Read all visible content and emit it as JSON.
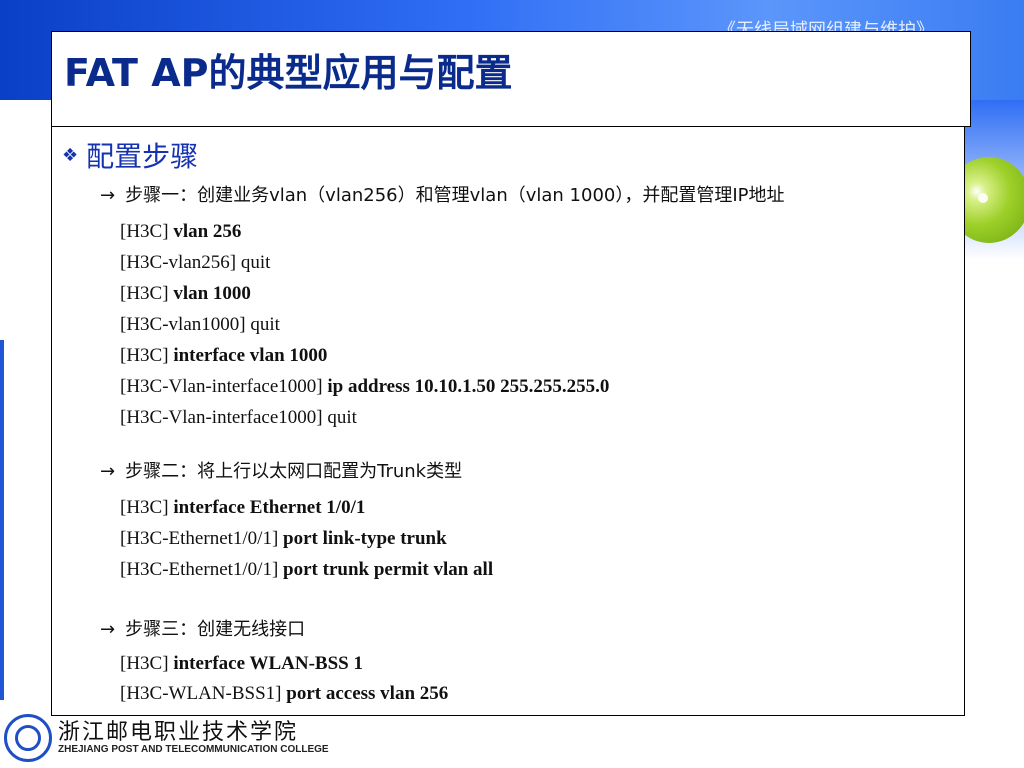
{
  "banner": {
    "course_title": "《无线局域网组建与维护》"
  },
  "slide": {
    "title": "FAT AP的典型应用与配置",
    "heading_bullet": "❖",
    "heading": "配置步骤",
    "arrow": "→",
    "steps": [
      {
        "label": "步骤一：创建业务vlan（vlan256）和管理vlan（vlan 1000），并配置管理IP地址",
        "commands": [
          {
            "prompt": "[H3C]",
            "cmd": "vlan 256"
          },
          {
            "prompt": "[H3C-vlan256] quit",
            "cmd": ""
          },
          {
            "prompt": "[H3C]",
            "cmd": "vlan 1000"
          },
          {
            "prompt": "[H3C-vlan1000] quit",
            "cmd": ""
          },
          {
            "prompt": "[H3C]",
            "cmd": "interface vlan 1000"
          },
          {
            "prompt": "[H3C-Vlan-interface1000]",
            "cmd": "ip address 10.10.1.50 255.255.255.0"
          },
          {
            "prompt": "[H3C-Vlan-interface1000] quit",
            "cmd": ""
          }
        ]
      },
      {
        "label": "步骤二：将上行以太网口配置为Trunk类型",
        "commands": [
          {
            "prompt": "[H3C]",
            "cmd": "interface Ethernet 1/0/1"
          },
          {
            "prompt": "[H3C-Ethernet1/0/1]",
            "cmd": "port link-type trunk"
          },
          {
            "prompt": "[H3C-Ethernet1/0/1]",
            "cmd": "port trunk permit vlan all"
          }
        ]
      },
      {
        "label": "步骤三：创建无线接口",
        "commands": [
          {
            "prompt": "[H3C]",
            "cmd": "interface WLAN-BSS 1"
          },
          {
            "prompt": "[H3C-WLAN-BSS1]",
            "cmd": "port access vlan 256"
          }
        ]
      }
    ]
  },
  "footer": {
    "college_cn": "浙江邮电职业技术学院",
    "college_en": "ZHEJIANG POST AND TELECOMMUNICATION COLLEGE"
  },
  "colors": {
    "title": "#0a2a8c",
    "heading": "#1533b0",
    "band": "#2f6ef5",
    "accent_ball": "#9ed02a"
  }
}
